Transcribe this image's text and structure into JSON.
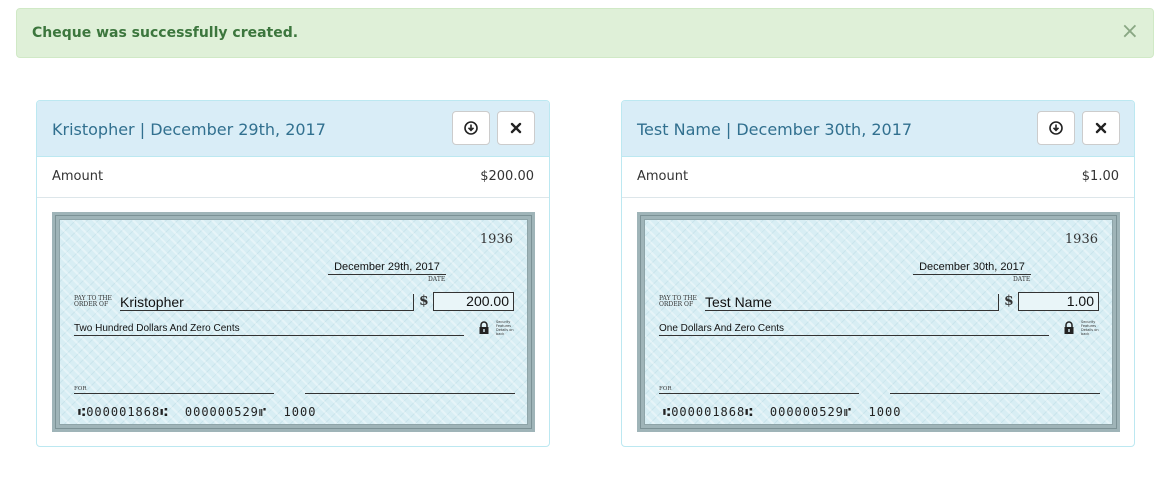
{
  "alert": {
    "message": "Cheque was successfully created.",
    "close_label": "×"
  },
  "cheques": [
    {
      "title": "Kristopher | December 29th, 2017",
      "amount_label": "Amount",
      "amount_value": "$200.00",
      "cheque": {
        "number": "1936",
        "date": "December 29th, 2017",
        "date_label": "DATE",
        "pay_to_label_1": "PAY TO THE",
        "pay_to_label_2": "ORDER OF",
        "payee": "Kristopher",
        "currency_symbol": "$",
        "amount": "200.00",
        "amount_words": "Two Hundred Dollars And Zero Cents",
        "security_text": "Security Features Details on back",
        "for_label": "FOR",
        "micr": "⑆000001868⑆  000000529⑈  1000"
      }
    },
    {
      "title": "Test Name | December 30th, 2017",
      "amount_label": "Amount",
      "amount_value": "$1.00",
      "cheque": {
        "number": "1936",
        "date": "December 30th, 2017",
        "date_label": "DATE",
        "pay_to_label_1": "PAY TO THE",
        "pay_to_label_2": "ORDER OF",
        "payee": "Test Name",
        "currency_symbol": "$",
        "amount": "1.00",
        "amount_words": "One Dollars And Zero Cents",
        "security_text": "Security Features Details on back",
        "for_label": "FOR",
        "micr": "⑆000001868⑆  000000529⑈  1000"
      }
    }
  ],
  "icons": {
    "download": "download-circle-icon",
    "delete": "close-x-icon",
    "lock": "lock-icon"
  },
  "colors": {
    "alert_bg": "#dff0d8",
    "alert_text": "#3c763d",
    "panel_heading_bg": "#d9edf7",
    "panel_title": "#31708f",
    "cheque_bg": "#d8eef4"
  }
}
